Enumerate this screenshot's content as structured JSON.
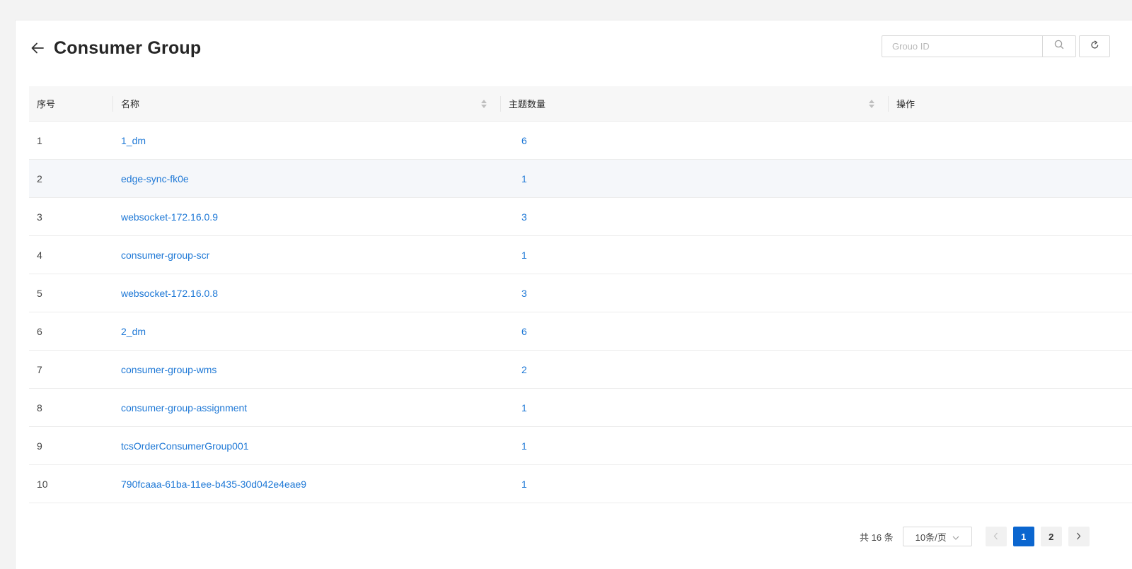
{
  "header": {
    "title": "Consumer Group"
  },
  "search": {
    "placeholder": "Grouo ID",
    "value": ""
  },
  "table": {
    "columns": [
      "序号",
      "名称",
      "主题数量",
      "操作"
    ],
    "rows": [
      {
        "index": "1",
        "name": "1_dm",
        "topics": "6"
      },
      {
        "index": "2",
        "name": "edge-sync-fk0e",
        "topics": "1"
      },
      {
        "index": "3",
        "name": "websocket-172.16.0.9",
        "topics": "3"
      },
      {
        "index": "4",
        "name": "consumer-group-scr",
        "topics": "1"
      },
      {
        "index": "5",
        "name": "websocket-172.16.0.8",
        "topics": "3"
      },
      {
        "index": "6",
        "name": "2_dm",
        "topics": "6"
      },
      {
        "index": "7",
        "name": "consumer-group-wms",
        "topics": "2"
      },
      {
        "index": "8",
        "name": "consumer-group-assignment",
        "topics": "1"
      },
      {
        "index": "9",
        "name": "tcsOrderConsumerGroup001",
        "topics": "1"
      },
      {
        "index": "10",
        "name": "790fcaaa-61ba-11ee-b435-30d042e4eae9",
        "topics": "1"
      }
    ]
  },
  "pagination": {
    "total_label": "共 16 条",
    "page_size": "10条/页",
    "pages": [
      "1",
      "2"
    ],
    "current_page": "1"
  },
  "colors": {
    "accent": "#0b66cf",
    "link": "#1e78d6"
  }
}
